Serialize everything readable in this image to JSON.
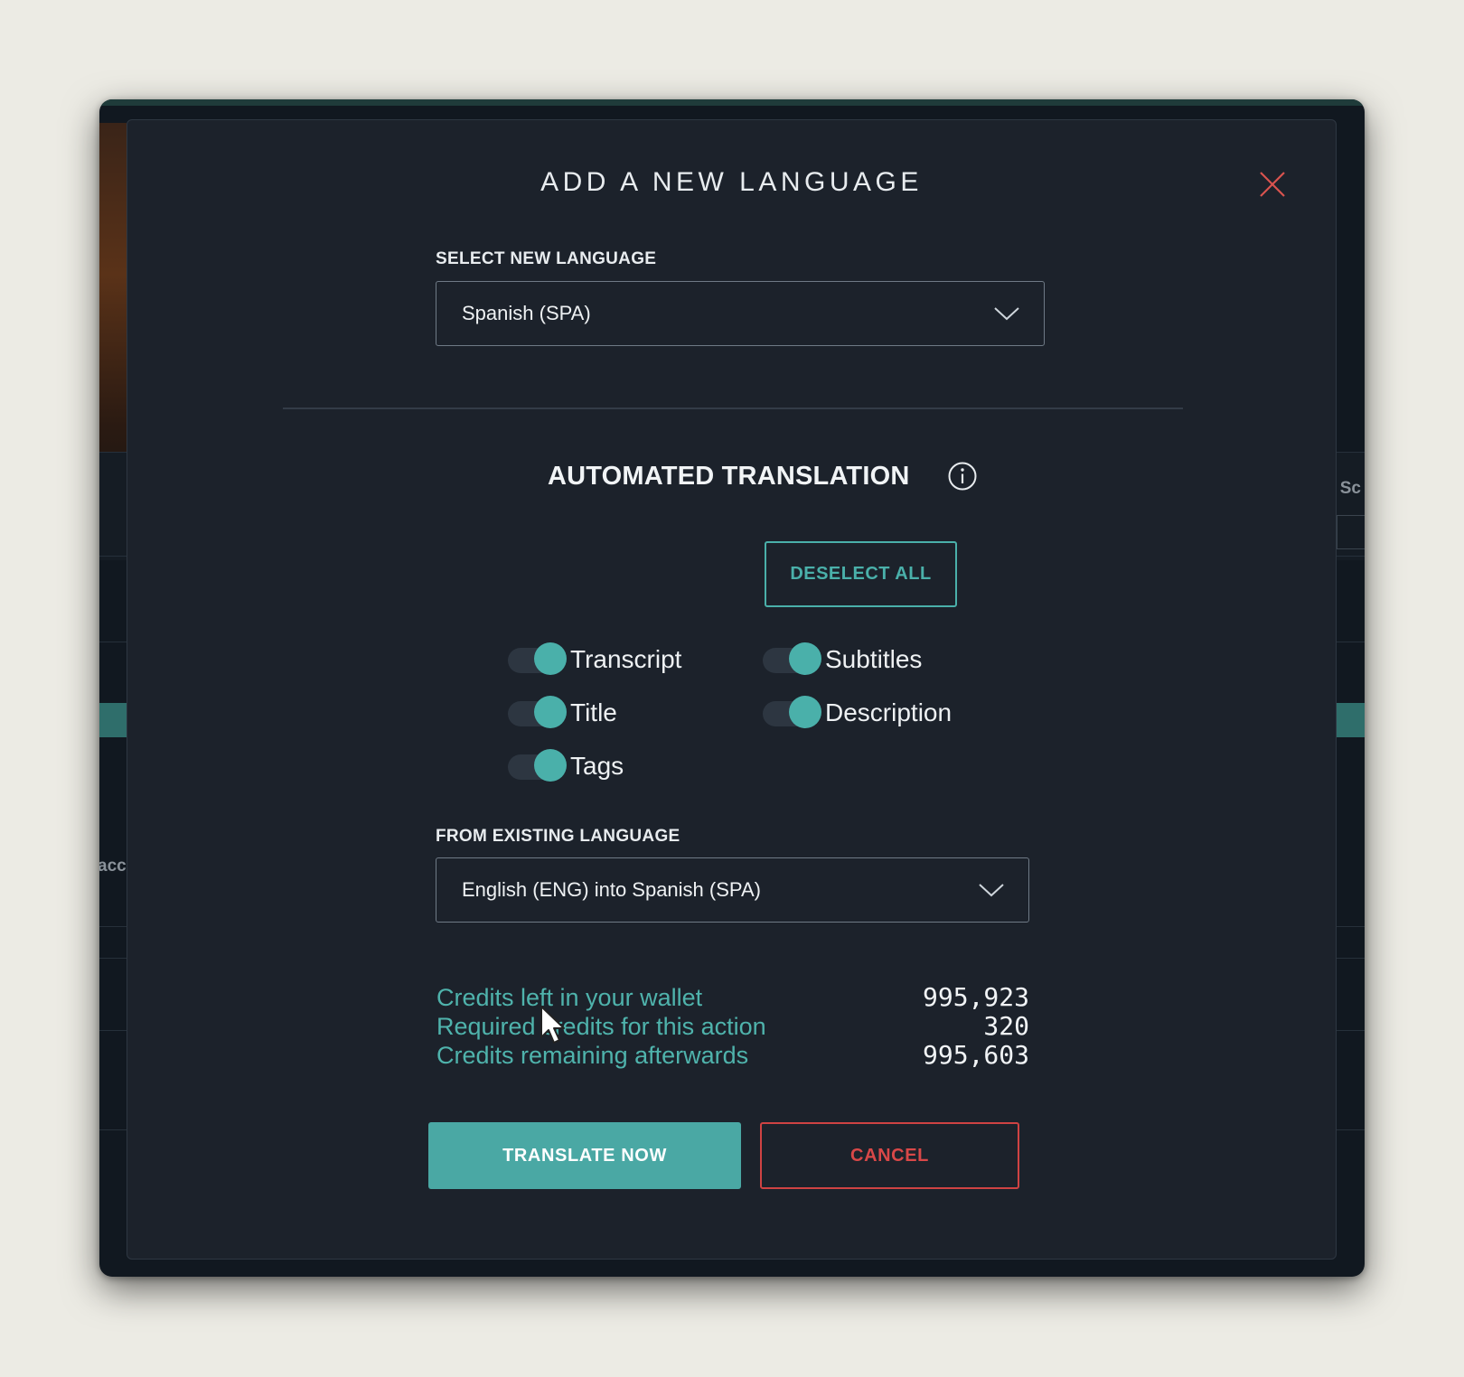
{
  "modal": {
    "title": "ADD A NEW LANGUAGE",
    "close_icon": "close-icon",
    "select_language": {
      "label": "SELECT NEW LANGUAGE",
      "value": "Spanish (SPA)"
    },
    "automated_translation": {
      "title": "AUTOMATED TRANSLATION",
      "info_icon": "info-icon",
      "deselect_all_label": "DESELECT ALL",
      "toggles": [
        {
          "label": "Transcript",
          "on": true
        },
        {
          "label": "Subtitles",
          "on": true
        },
        {
          "label": "Title",
          "on": true
        },
        {
          "label": "Description",
          "on": true
        },
        {
          "label": "Tags",
          "on": true
        }
      ]
    },
    "from_language": {
      "label": "FROM EXISTING LANGUAGE",
      "value": "English (ENG) into Spanish (SPA)"
    },
    "credits": [
      {
        "label": "Credits left in your wallet",
        "value": "995,923"
      },
      {
        "label": "Required credits for this action",
        "value": "320"
      },
      {
        "label": "Credits remaining afterwards",
        "value": "995,603"
      }
    ],
    "buttons": {
      "translate_label": "TRANSLATE NOW",
      "cancel_label": "CANCEL"
    }
  },
  "background": {
    "right_fragment": "Sc",
    "left_fragment": "acc"
  },
  "colors": {
    "accent": "#4aa8a4",
    "danger": "#cf4343",
    "modal_bg": "#1c222b",
    "page_bg": "#ecebe4"
  }
}
